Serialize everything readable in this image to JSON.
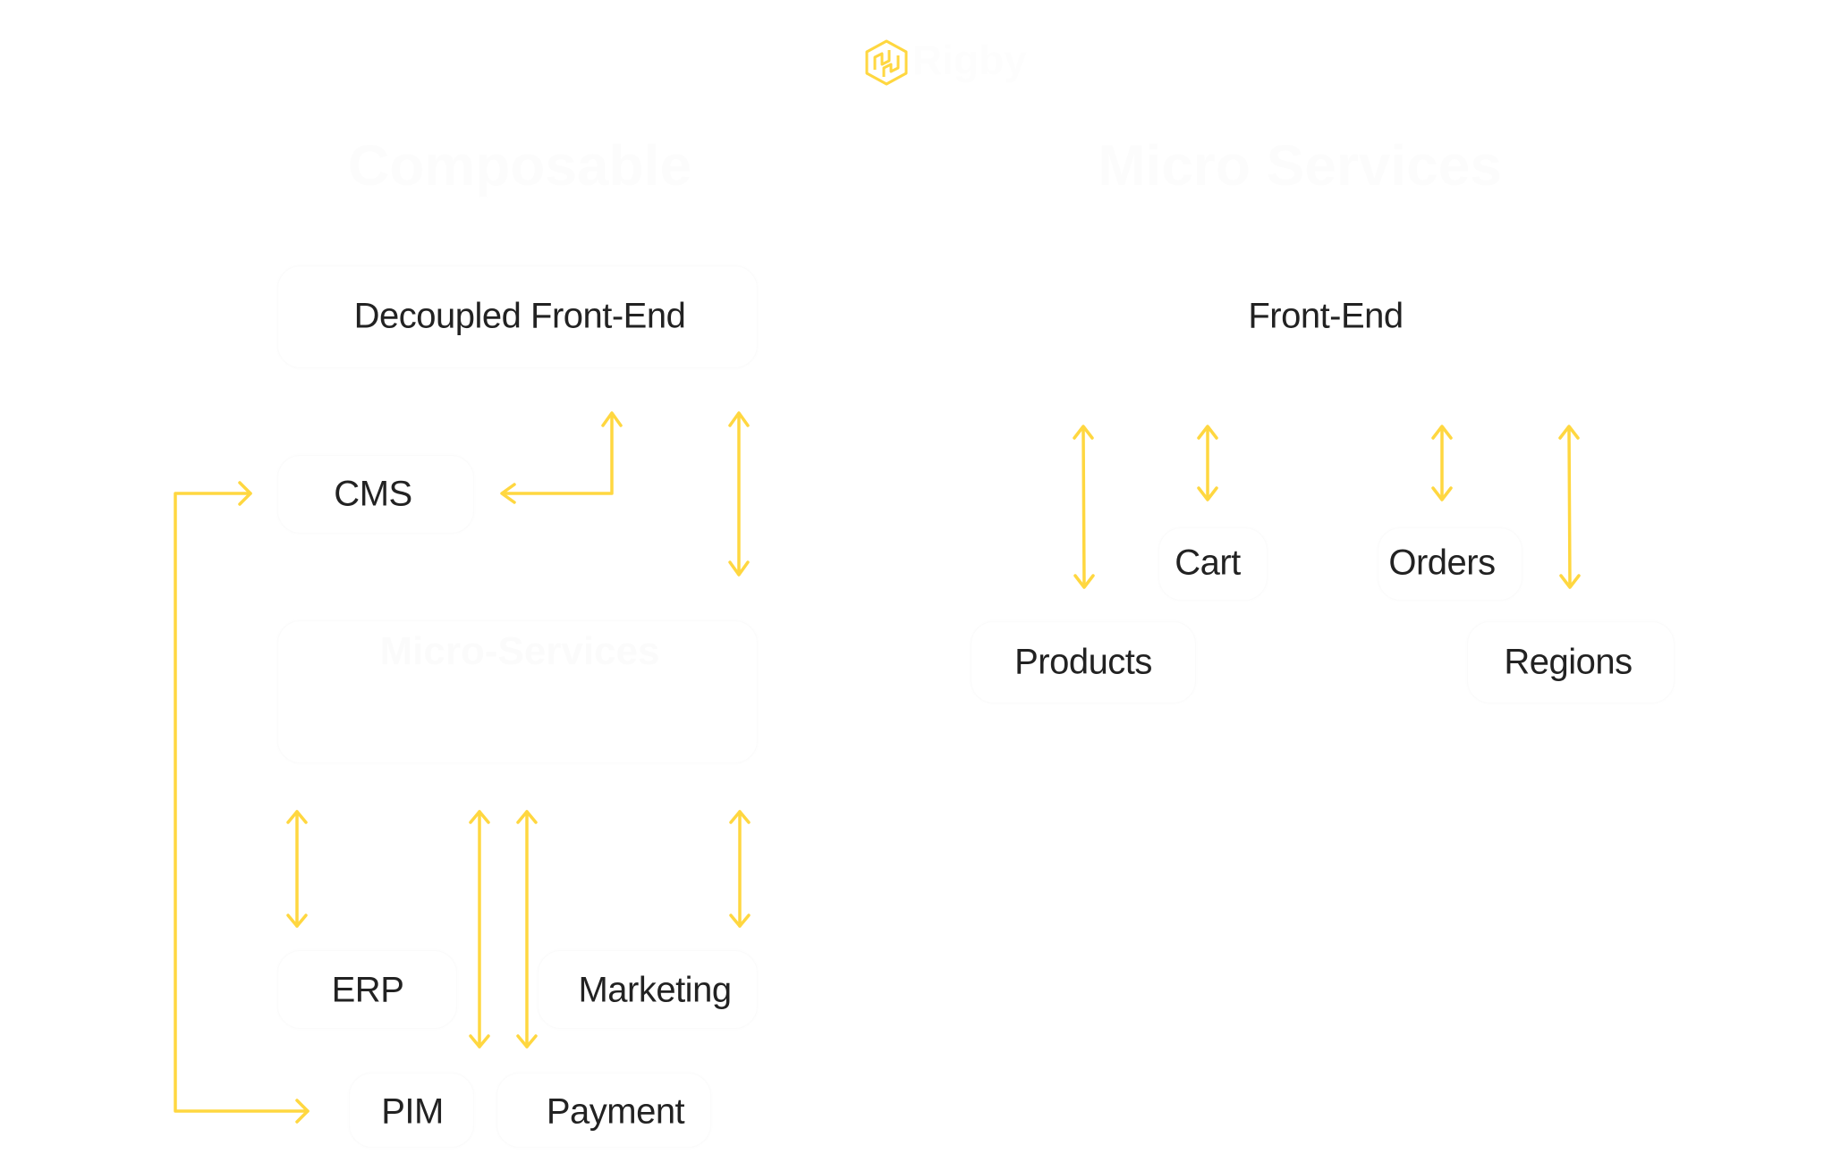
{
  "brand": {
    "logo_icon": "rigby-hexagon-icon",
    "name": "Rigby",
    "accent_color": "#FFD740"
  },
  "columns": {
    "left_title": "Composable",
    "right_title": "Micro Services"
  },
  "left_diagram": {
    "frontend": "Decoupled Front-End",
    "cms": "CMS",
    "services_box_title": "Micro-Services",
    "erp": "ERP",
    "marketing": "Marketing",
    "pim": "PIM",
    "payment": "Payment"
  },
  "right_diagram": {
    "frontend": "Front-End",
    "products": "Products",
    "cart": "Cart",
    "orders": "Orders",
    "regions": "Regions"
  },
  "colors": {
    "arrow": "#FFD740",
    "text": "#222222",
    "background": "#FFFFFF"
  }
}
